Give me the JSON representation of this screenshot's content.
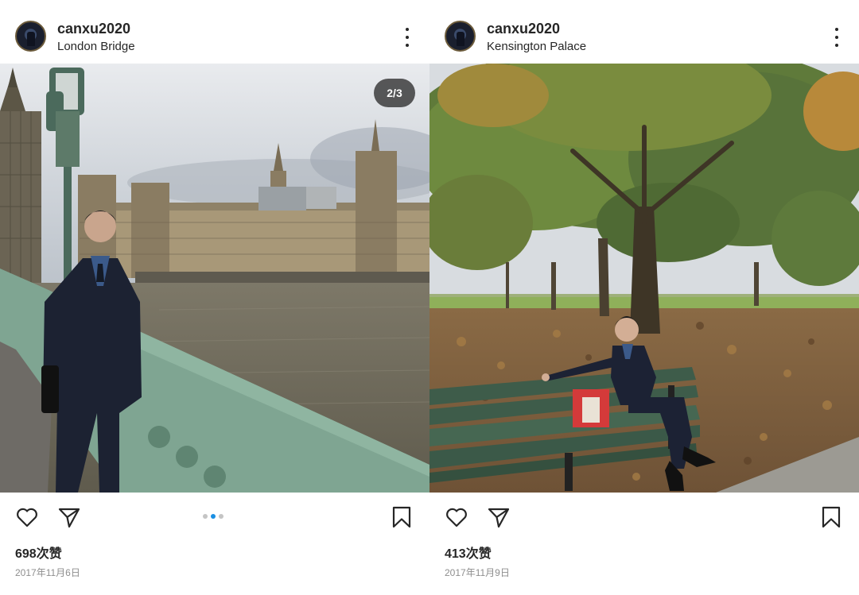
{
  "posts": [
    {
      "username": "canxu2020",
      "location": "London Bridge",
      "image_counter": "2/3",
      "likes": "698次赞",
      "date": "2017年11月6日",
      "carousel": {
        "count": 3,
        "active_index": 1
      },
      "icons": {
        "avatar": "profile-avatar",
        "more": "more-options-icon",
        "like": "heart-icon",
        "share": "send-icon",
        "save": "bookmark-icon"
      }
    },
    {
      "username": "canxu2020",
      "location": "Kensington Palace",
      "likes": "413次赞",
      "date": "2017年11月9日",
      "icons": {
        "avatar": "profile-avatar",
        "more": "more-options-icon",
        "like": "heart-icon",
        "share": "send-icon",
        "save": "bookmark-icon"
      }
    }
  ],
  "colors": {
    "text": "#262626",
    "muted": "#8e8e8e",
    "active_dot": "#1a8fe3",
    "inactive_dot": "#c4c4c4"
  }
}
